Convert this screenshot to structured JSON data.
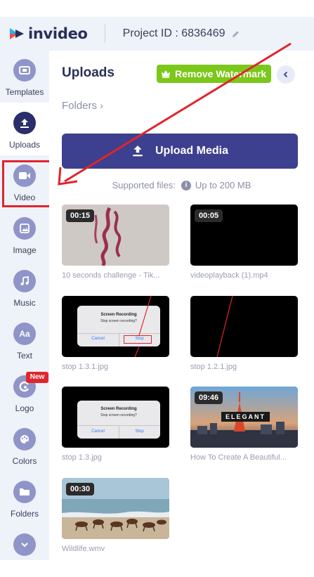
{
  "header": {
    "brand": "invideo",
    "project_label": "Project ID : 6836469"
  },
  "sidebar": {
    "items": [
      {
        "label": "Templates",
        "icon": "templates-icon"
      },
      {
        "label": "Uploads",
        "icon": "upload-icon"
      },
      {
        "label": "Video",
        "icon": "video-icon"
      },
      {
        "label": "Image",
        "icon": "image-icon"
      },
      {
        "label": "Music",
        "icon": "music-icon"
      },
      {
        "label": "Text",
        "icon": "text-icon",
        "glyph": "Aa"
      },
      {
        "label": "Logo",
        "icon": "logo-icon"
      },
      {
        "label": "Colors",
        "icon": "palette-icon"
      },
      {
        "label": "Folders",
        "icon": "folder-icon"
      },
      {
        "label": "",
        "icon": "chevron-down-icon"
      }
    ],
    "new_badge": "New",
    "active_item": "Uploads"
  },
  "panel": {
    "title": "Uploads",
    "remove_watermark": "Remove Watermark",
    "folders_link": "Folders",
    "upload_button": "Upload Media",
    "supported_label": "Supported files:",
    "supported_limit": "Up to 200 MB"
  },
  "uploads": [
    {
      "name": "10 seconds challenge - Tik...",
      "duration": "00:15"
    },
    {
      "name": "videoplayback (1).mp4",
      "duration": "00:05"
    },
    {
      "name": "stop 1.3.1.jpg",
      "duration": ""
    },
    {
      "name": "stop 1.2.1.jpg",
      "duration": ""
    },
    {
      "name": "stop 1.3.jpg",
      "duration": ""
    },
    {
      "name": "How To Create A Beautiful...",
      "duration": "09:46"
    },
    {
      "name": "Wildlife.wmv",
      "duration": "00:30"
    }
  ],
  "dialog": {
    "title": "Screen Recording",
    "subtitle": "Stop screen recording?",
    "cancel": "Cancel",
    "stop": "Stop"
  },
  "thumb_text": {
    "elegant": "ELEGANT"
  },
  "colors": {
    "accent": "#3d3f8f",
    "watermark_green": "#7bc71a",
    "annotation_red": "#e0252c",
    "sidebar_bg": "#eef2f9"
  }
}
